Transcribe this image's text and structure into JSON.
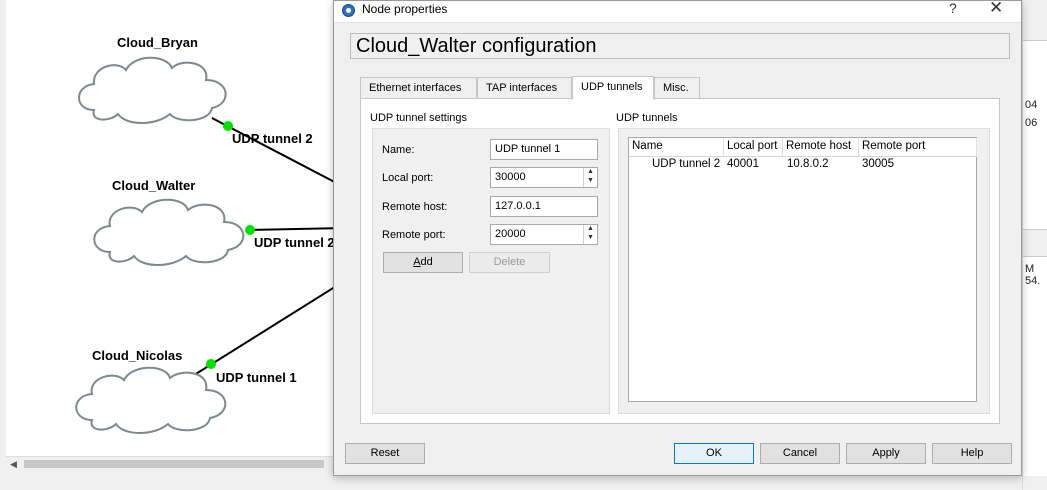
{
  "topology": {
    "nodes": [
      {
        "name": "Cloud_Bryan"
      },
      {
        "name": "Cloud_Walter"
      },
      {
        "name": "Cloud_Nicolas"
      }
    ],
    "links": [
      {
        "label": "UDP tunnel 2"
      },
      {
        "label": "UDP tunnel 2"
      },
      {
        "label": "UDP tunnel 1"
      }
    ],
    "link_endpoint_color": "#00e000",
    "cloud_stroke_color": "#7a8a8e"
  },
  "right_fragments": [
    "04",
    "06",
    "M 54."
  ],
  "dialog": {
    "window_title": "Node properties",
    "help_glyph": "?",
    "close_glyph": "✕",
    "header": "Cloud_Walter configuration",
    "tabs": [
      {
        "label": "Ethernet interfaces"
      },
      {
        "label": "TAP interfaces"
      },
      {
        "label": "UDP tunnels",
        "active": true
      },
      {
        "label": "Misc."
      }
    ],
    "settings": {
      "section_title": "UDP tunnel settings",
      "name_label": "Name:",
      "name_value": "UDP tunnel 1",
      "local_port_label": "Local port:",
      "local_port_value": "30000",
      "remote_host_label": "Remote host:",
      "remote_host_value": "127.0.0.1",
      "remote_port_label": "Remote port:",
      "remote_port_value": "20000",
      "add_label": "Add",
      "delete_label": "Delete"
    },
    "tunnels": {
      "section_title": "UDP tunnels",
      "columns": [
        "Name",
        "Local port",
        "Remote host",
        "Remote port"
      ],
      "rows": [
        [
          "UDP tunnel 2",
          "40001",
          "10.8.0.2",
          "30005"
        ]
      ]
    },
    "buttons": {
      "reset": "Reset",
      "ok": "OK",
      "cancel": "Cancel",
      "apply": "Apply",
      "help": "Help"
    }
  }
}
